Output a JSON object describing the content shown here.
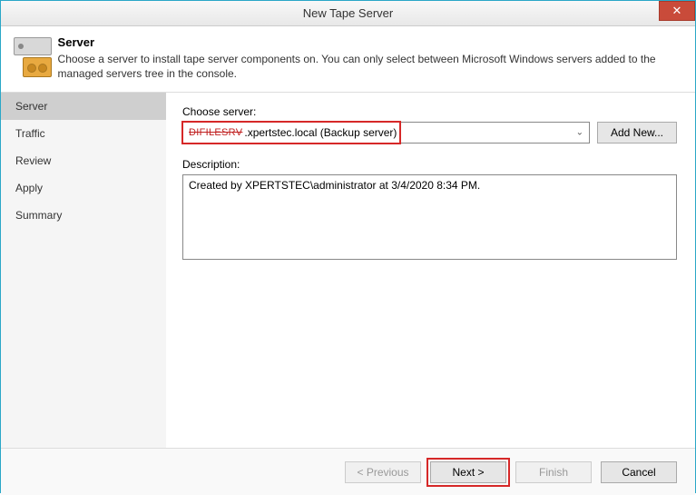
{
  "window": {
    "title": "New Tape Server"
  },
  "header": {
    "title": "Server",
    "subtitle": "Choose a server to install tape server components on. You can only select between Microsoft Windows servers added to the managed servers tree in the console."
  },
  "sidebar": {
    "items": [
      {
        "label": "Server",
        "active": true
      },
      {
        "label": "Traffic",
        "active": false
      },
      {
        "label": "Review",
        "active": false
      },
      {
        "label": "Apply",
        "active": false
      },
      {
        "label": "Summary",
        "active": false
      }
    ]
  },
  "main": {
    "choose_label": "Choose server:",
    "server_redacted": "DIFILESRV",
    "server_suffix": ".xpertstec.local (Backup server)",
    "addnew_label": "Add New...",
    "description_label": "Description:",
    "description_value": "Created by XPERTSTEC\\administrator at 3/4/2020 8:34 PM."
  },
  "footer": {
    "previous": "< Previous",
    "next": "Next >",
    "finish": "Finish",
    "cancel": "Cancel"
  }
}
